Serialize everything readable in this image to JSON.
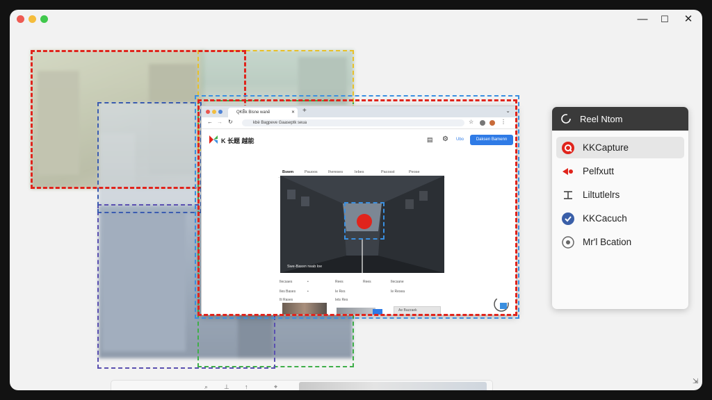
{
  "window": {
    "controls": [
      "minimize",
      "maximize",
      "close"
    ],
    "minimize_glyph": "—",
    "maximize_glyph": "☐",
    "close_glyph": "✕"
  },
  "colors": {
    "red_dash": "#e0241c",
    "blue_dash": "#3a8fe0",
    "yellow_dash": "#e8c028",
    "green_dash": "#3fae49",
    "purple_dash": "#5a4fb0",
    "menu_header": "#3a3a3a",
    "accent_blue": "#2f7be6"
  },
  "browser": {
    "tab_title": "QKB̃k Bisne wanẽ",
    "new_tab_glyph": "+",
    "address": "kbè Bagpeve Gaaseptk seua",
    "site_logo_text": "K 长题 越能",
    "header_link": "Ubo",
    "header_button": "Daksen Bamenn",
    "nav_tabs": [
      "Bswm",
      "Pauoos",
      "Ihereses",
      "Iebes",
      "Pacosst",
      "Peose"
    ],
    "hero_caption": "Swe-Bassn rwab loe",
    "info_rows": [
      [
        "Ilecsaes",
        "•",
        "Rees",
        "Rees",
        "Ilecsane"
      ],
      [
        "Iles Bases",
        "•",
        "Ie Res",
        "Ie Resea",
        "•"
      ],
      [
        "Ili Rases",
        "",
        "Iets Res",
        "",
        ""
      ]
    ],
    "panel_label": "Ae Bazzaek"
  },
  "context_menu": {
    "header": "Reel Ntom",
    "items": [
      {
        "label": "KKCapture",
        "icon": "kkcapture-logo-icon",
        "selected": true
      },
      {
        "label": "Pelfxutt",
        "icon": "red-arrow-icon",
        "selected": false
      },
      {
        "label": "Liltutlelrs",
        "icon": "crop-bar-icon",
        "selected": false
      },
      {
        "label": "KKCacuch",
        "icon": "check-circle-icon",
        "selected": false
      },
      {
        "label": "Mr'l Bcation",
        "icon": "location-circle-icon",
        "selected": false
      }
    ]
  },
  "dock": {
    "icons": [
      "search-icon",
      "pin-icon",
      "pointer-icon",
      "cursor-icon"
    ]
  }
}
